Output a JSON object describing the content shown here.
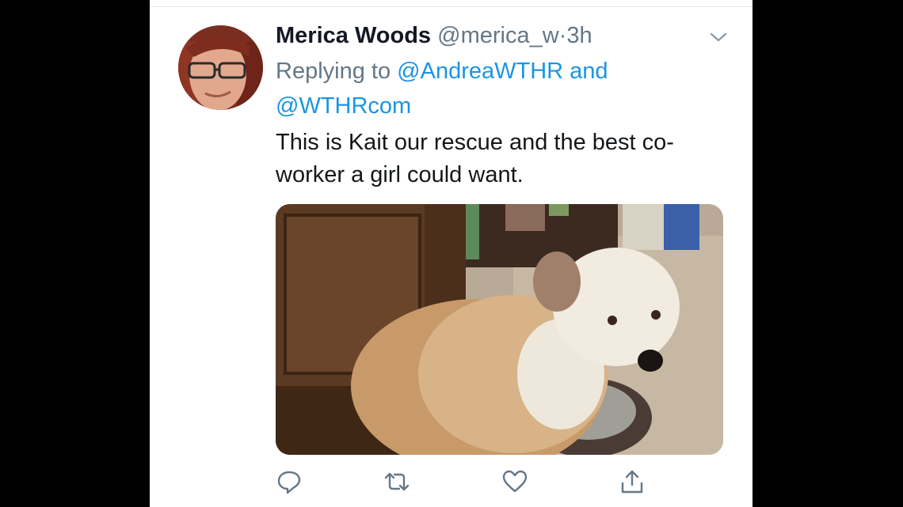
{
  "tweet": {
    "display_name": "Merica Woods",
    "handle": "@merica_w",
    "separator": "·",
    "time": "3h",
    "replying_prefix": "Replying to",
    "mention_1": "@AndreaWTHR",
    "conjunction": "and",
    "mention_2": "@WTHRcom",
    "body_text": "This is Kait our rescue and the best co-worker a girl could want."
  },
  "icons": {
    "more": "chevron-down-icon",
    "reply": "reply-icon",
    "retweet": "retweet-icon",
    "like": "heart-icon",
    "share": "share-icon"
  },
  "colors": {
    "link": "#1b95e0",
    "muted": "#657786",
    "text": "#14171a",
    "icon": "#657786"
  }
}
